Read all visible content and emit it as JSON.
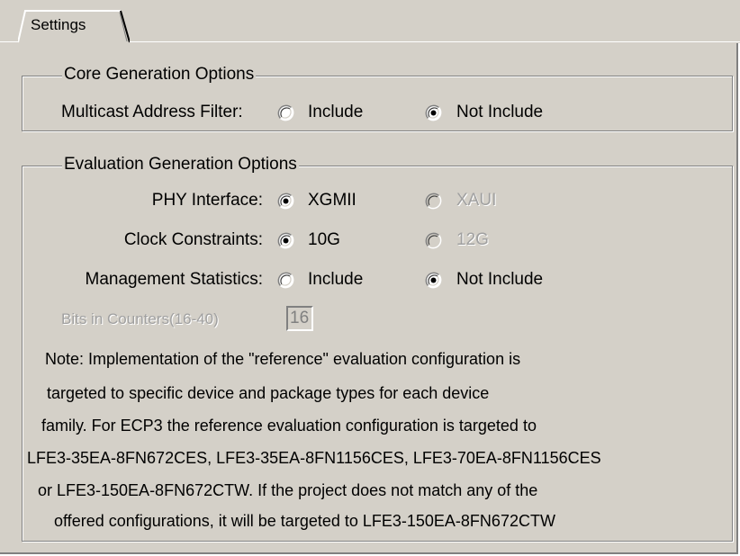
{
  "tabs": [
    {
      "label": "Settings"
    }
  ],
  "core": {
    "legend": "Core Generation Options",
    "multicast": {
      "label": "Multicast Address Filter:",
      "opt1": "Include",
      "opt2": "Not Include",
      "selected": "Not Include"
    }
  },
  "eval": {
    "legend": "Evaluation Generation Options",
    "phy": {
      "label": "PHY Interface:",
      "opt1": "XGMII",
      "opt2": "XAUI",
      "selected": "XGMII"
    },
    "clock": {
      "label": "Clock Constraints:",
      "opt1": "10G",
      "opt2": "12G",
      "selected": "10G"
    },
    "mgmt": {
      "label": "Management Statistics:",
      "opt1": "Include",
      "opt2": "Not Include",
      "selected": "Not Include"
    },
    "bits": {
      "label": "Bits in Counters(16-40)",
      "value": "16"
    },
    "note": [
      "Note:  Implementation of the \"reference\" evaluation configuration is",
      "targeted to specific device and package types for each device",
      "family. For ECP3 the reference evaluation configuration is targeted to",
      "LFE3-35EA-8FN672CES, LFE3-35EA-8FN1156CES, LFE3-70EA-8FN1156CES",
      "or LFE3-150EA-8FN672CTW. If the project does not match any of the",
      "offered configurations, it will be targeted to LFE3-150EA-8FN672CTW"
    ]
  }
}
